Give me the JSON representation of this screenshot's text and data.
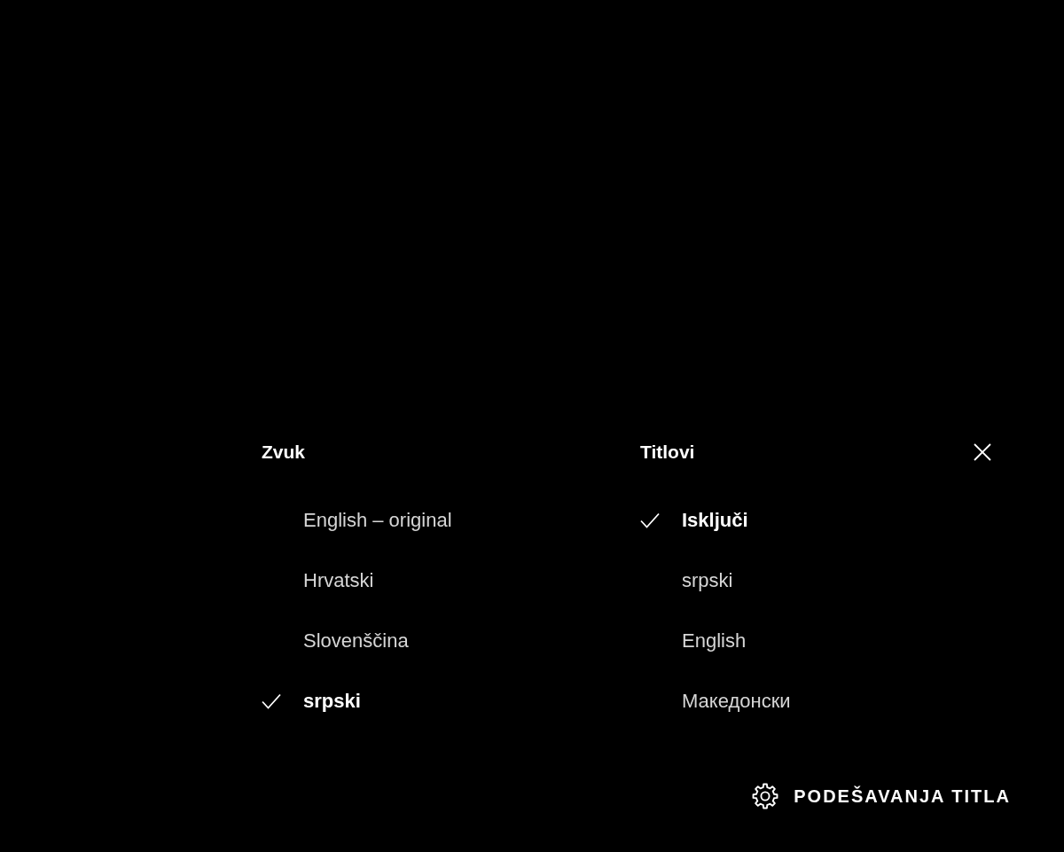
{
  "audio": {
    "heading": "Zvuk",
    "options": [
      {
        "label": "English – original",
        "selected": false
      },
      {
        "label": "Hrvatski",
        "selected": false
      },
      {
        "label": "Slovenščina",
        "selected": false
      },
      {
        "label": "srpski",
        "selected": true
      }
    ]
  },
  "subtitles": {
    "heading": "Titlovi",
    "options": [
      {
        "label": "Isključi",
        "selected": true
      },
      {
        "label": "srpski",
        "selected": false
      },
      {
        "label": "English",
        "selected": false
      },
      {
        "label": "Македонски",
        "selected": false
      }
    ]
  },
  "settings_button": {
    "label": "PODEŠAVANJA TITLA"
  }
}
